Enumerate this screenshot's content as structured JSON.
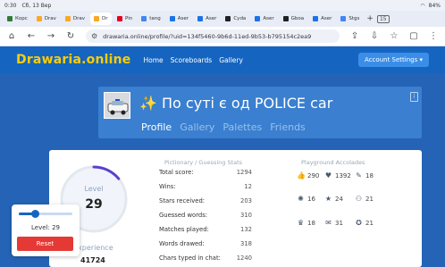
{
  "status_bar": {
    "time": "0:30",
    "date": "Сб, 13 Вер",
    "battery": "84%"
  },
  "browser": {
    "tabs": [
      {
        "label": "Корс",
        "color": "#2e7d32",
        "active": false
      },
      {
        "label": "Drav",
        "color": "#f9a825",
        "active": false
      },
      {
        "label": "Drav",
        "color": "#f9a825",
        "active": false
      },
      {
        "label": "Dr",
        "color": "#f9a825",
        "active": true
      },
      {
        "label": "Pin",
        "color": "#e60023",
        "active": false
      },
      {
        "label": "tang",
        "color": "#4285f4",
        "active": false
      },
      {
        "label": "Aser",
        "color": "#1a73e8",
        "active": false
      },
      {
        "label": "Aser",
        "color": "#1a73e8",
        "active": false
      },
      {
        "label": "Cyda",
        "color": "#202124",
        "active": false
      },
      {
        "label": "Aser",
        "color": "#1a73e8",
        "active": false
      },
      {
        "label": "Gboa",
        "color": "#202124",
        "active": false
      },
      {
        "label": "Aser",
        "color": "#1a73e8",
        "active": false
      },
      {
        "label": "Stgs",
        "color": "#4285f4",
        "active": false
      }
    ],
    "tab_count": "15",
    "url": "drawaria.online/profile/?uid=134f5460-9b6d-11ed-9b53-b795154c2ea9"
  },
  "site_nav": {
    "logo": "Drawaria.online",
    "links": [
      "Home",
      "Scoreboards",
      "Gallery"
    ],
    "account_button": "Account Settings ▾"
  },
  "profile": {
    "title_spark": "✨",
    "title": "По суті є од POLICE car",
    "tabs": [
      "Profile",
      "Gallery",
      "Palettes",
      "Friends"
    ],
    "menu_icon": "⁝"
  },
  "level": {
    "label": "Level",
    "value": "29",
    "experience_label": "Experience",
    "experience_value": "41724",
    "progress": 0.14
  },
  "stats": {
    "title": "Pictionary / Guessing Stats",
    "rows": [
      {
        "label": "Total score:",
        "value": "1294"
      },
      {
        "label": "Wins:",
        "value": "12"
      },
      {
        "label": "Stars received:",
        "value": "203"
      },
      {
        "label": "Guessed words:",
        "value": "310"
      },
      {
        "label": "Matches played:",
        "value": "132"
      },
      {
        "label": "Words drawed:",
        "value": "318"
      },
      {
        "label": "Chars typed in chat:",
        "value": "1240"
      }
    ]
  },
  "accolades": {
    "title": "Playground Accolades",
    "items": [
      {
        "icon": "thumbs-up-icon",
        "glyph": "👍",
        "value": "290"
      },
      {
        "icon": "heart-icon",
        "glyph": "♥",
        "value": "1392"
      },
      {
        "icon": "brush-icon",
        "glyph": "✎",
        "value": "18"
      },
      {
        "icon": "bulb-icon",
        "glyph": "✺",
        "value": "16"
      },
      {
        "icon": "star-icon",
        "glyph": "★",
        "value": "24"
      },
      {
        "icon": "people-icon",
        "glyph": "⚇",
        "value": "21"
      },
      {
        "icon": "trophy-icon",
        "glyph": "♛",
        "value": "18"
      },
      {
        "icon": "gift-icon",
        "glyph": "✉",
        "value": "31"
      },
      {
        "icon": "medal-icon",
        "glyph": "✪",
        "value": "21"
      }
    ]
  },
  "overlay": {
    "level_text": "Level: 29",
    "reset_label": "Reset",
    "slider_value": 0.3
  }
}
